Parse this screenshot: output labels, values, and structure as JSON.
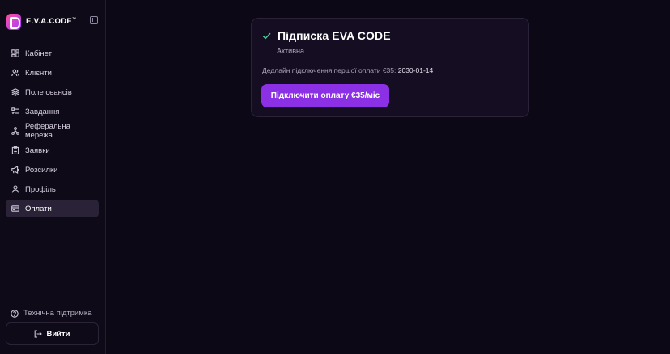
{
  "brand": {
    "name": "E.V.A.CODE",
    "trademark": "™",
    "logo_gradient": [
      "#ff4fa0",
      "#a33bff"
    ]
  },
  "sidebar": {
    "items": [
      {
        "label": "Кабінет",
        "icon": "dashboard-icon",
        "active": false
      },
      {
        "label": "Клієнти",
        "icon": "users-icon",
        "active": false
      },
      {
        "label": "Поле сеансів",
        "icon": "layers-icon",
        "active": false
      },
      {
        "label": "Завдання",
        "icon": "tasks-icon",
        "active": false
      },
      {
        "label": "Реферальна мережа",
        "icon": "network-icon",
        "active": false
      },
      {
        "label": "Заявки",
        "icon": "clipboard-icon",
        "active": false
      },
      {
        "label": "Розсилки",
        "icon": "megaphone-icon",
        "active": false
      },
      {
        "label": "Профіль",
        "icon": "user-icon",
        "active": false
      },
      {
        "label": "Оплати",
        "icon": "card-icon",
        "active": true
      }
    ],
    "support_label": "Технічна підтримка",
    "logout_label": "Вийти"
  },
  "subscription": {
    "title": "Підписка EVA CODE",
    "status": "Активна",
    "deadline_label": "Дедлайн підключення першої оплати €35:",
    "deadline_date": "2030-01-14",
    "pay_button_label": "Підключити оплату €35/міс"
  },
  "colors": {
    "accent": "#8c30e6",
    "success": "#3fcf8e",
    "background": "#0d0816",
    "active_nav": "#2a2338"
  }
}
